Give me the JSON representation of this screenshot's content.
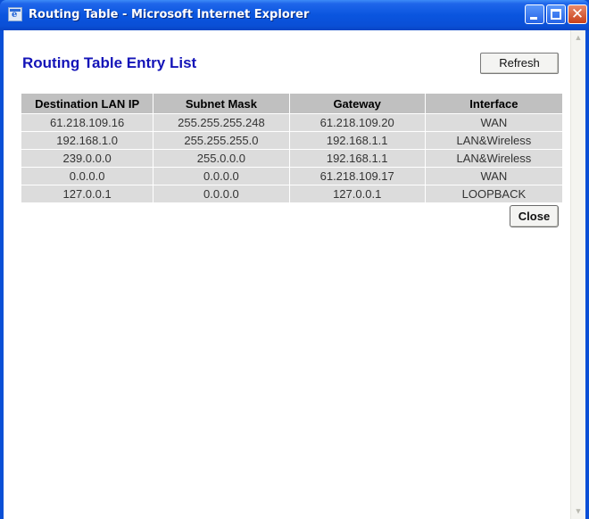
{
  "window": {
    "title": "Routing Table - Microsoft Internet Explorer",
    "icon": "internet-explorer-icon",
    "controls": {
      "minimize": "minimize-icon",
      "maximize": "maximize-icon",
      "close": "close-icon"
    },
    "close_glyph": "✕"
  },
  "page": {
    "title": "Routing Table Entry List",
    "refresh_label": "Refresh",
    "close_label": "Close"
  },
  "table": {
    "headers": [
      "Destination LAN IP",
      "Subnet Mask",
      "Gateway",
      "Interface"
    ],
    "rows": [
      [
        "61.218.109.16",
        "255.255.255.248",
        "61.218.109.20",
        "WAN"
      ],
      [
        "192.168.1.0",
        "255.255.255.0",
        "192.168.1.1",
        "LAN&Wireless"
      ],
      [
        "239.0.0.0",
        "255.0.0.0",
        "192.168.1.1",
        "LAN&Wireless"
      ],
      [
        "0.0.0.0",
        "0.0.0.0",
        "61.218.109.17",
        "WAN"
      ],
      [
        "127.0.0.1",
        "0.0.0.0",
        "127.0.0.1",
        "LOOPBACK"
      ]
    ]
  },
  "scrollbar": {
    "up_glyph": "▲",
    "down_glyph": "▼"
  },
  "colors": {
    "title_text": "#1414b8",
    "header_bg": "#c0c0c0",
    "row_bg": "#dcdcdc",
    "titlebar": "#0a4fd6"
  }
}
